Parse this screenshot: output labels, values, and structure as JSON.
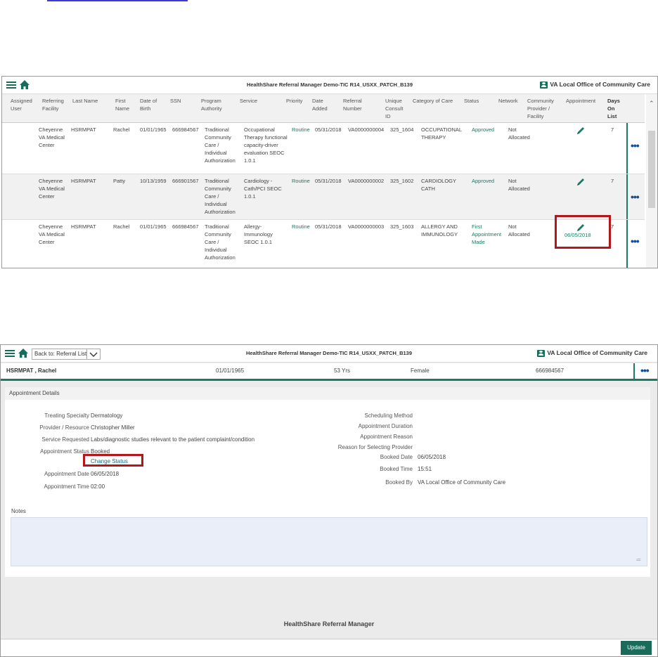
{
  "worklist": {
    "title": "HealthShare Referral Manager Demo-TIC R14_USXX_PATCH_B139",
    "office": "VA Local Office of Community Care",
    "columns": [
      "Assigned User",
      "Referring Facility",
      "Last Name",
      "First Name",
      "Date of Birth",
      "SSN",
      "Program Authority",
      "Service",
      "Priority",
      "Date Added",
      "Referral Number",
      "Unique Consult ID",
      "Category of Care",
      "Status",
      "Network",
      "Community Provider / Facility",
      "Appointment",
      "Days On List"
    ],
    "rows": [
      {
        "facility": "Cheyenne VA Medical Center",
        "last": "HSRMPAT",
        "first": "Rachel",
        "dob": "01/01/1965",
        "ssn": "666984567",
        "program": "Traditional Community Care / Individual Authorization",
        "service": "Occupational Therapy functional capacity-driver evaluation SEOC 1.0.1",
        "priority": "Routine",
        "added": "05/31/2018",
        "referral": "VA0000000004",
        "consult": "325_1604",
        "category": "OCCUPATIONAL THERAPY",
        "status": "Approved",
        "network": "Not Allocated",
        "appointment": "",
        "days": "7"
      },
      {
        "facility": "Cheyenne VA Medical Center",
        "last": "HSRMPAT",
        "first": "Patty",
        "dob": "10/13/1959",
        "ssn": "666901567",
        "program": "Traditional Community Care / Individual Authorization",
        "service": "Cardiology - Cath/PCI SEOC 1.0.1",
        "priority": "Routine",
        "added": "05/31/2018",
        "referral": "VA0000000002",
        "consult": "325_1602",
        "category": "CARDIOLOGY CATH",
        "status": "Approved",
        "network": "Not Allocated",
        "appointment": "",
        "days": "7"
      },
      {
        "facility": "Cheyenne VA Medical Center",
        "last": "HSRMPAT",
        "first": "Rachel",
        "dob": "01/01/1965",
        "ssn": "666984567",
        "program": "Traditional Community Care / Individual Authorization",
        "service": "Allergy-Immunology SEOC 1.0.1",
        "priority": "Routine",
        "added": "05/31/2018",
        "referral": "VA0000000003",
        "consult": "325_1603",
        "category": "ALLERGY AND IMMUNOLOGY",
        "status": "First Appointment Made",
        "network": "Not Allocated",
        "appointment": "06/05/2018",
        "days": "7"
      }
    ]
  },
  "appointment_page": {
    "back_label": "Back to: Referral List",
    "title": "HealthShare Referral Manager Demo-TIC R14_USXX_PATCH_B139",
    "office": "VA Local Office of Community Care",
    "patient": {
      "name": "HSRMPAT , Rachel",
      "dob": "01/01/1965",
      "age": "53 Yrs",
      "sex": "Female",
      "ssn": "666984567"
    },
    "section_title": "Appointment Details",
    "left_fields": [
      {
        "label": "Treating Specialty",
        "value": "Dermatology"
      },
      {
        "label": "Provider / Resource",
        "value": "Christopher Miller"
      },
      {
        "label": "Service Requested",
        "value": "Labs/diagnostic studies relevant to the patient complaint/condition"
      },
      {
        "label": "Appointment Status",
        "value": "Booked"
      },
      {
        "label": "Appointment Date",
        "value": "06/05/2018"
      },
      {
        "label": "Appointment Time",
        "value": "02:00"
      }
    ],
    "change_status_label": "Change Status",
    "right_fields": [
      {
        "label": "Scheduling Method",
        "value": ""
      },
      {
        "label": "Appointment Duration",
        "value": ""
      },
      {
        "label": "Appointment Reason",
        "value": ""
      },
      {
        "label": "Reason for Selecting Provider",
        "value": ""
      },
      {
        "label": "Booked Date",
        "value": "06/05/2018"
      },
      {
        "label": "Booked Time",
        "value": "15:51"
      },
      {
        "label": "Booked By",
        "value": "VA Local Office of Community Care"
      }
    ],
    "notes_label": "Notes",
    "footer_brand": "HealthShare Referral Manager",
    "update_label": "Update"
  }
}
